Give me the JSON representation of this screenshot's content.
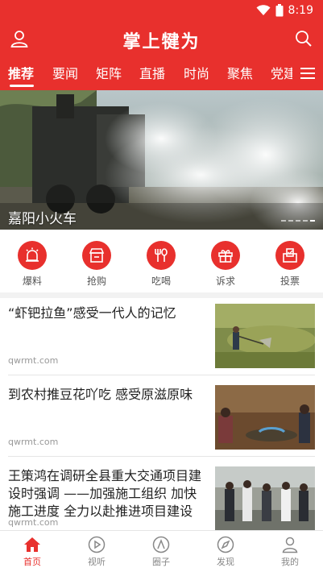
{
  "status_bar": {
    "time": "8:19"
  },
  "header": {
    "title": "掌上犍为"
  },
  "tabs": [
    {
      "label": "推荐",
      "active": true
    },
    {
      "label": "要闻"
    },
    {
      "label": "矩阵"
    },
    {
      "label": "直播"
    },
    {
      "label": "时尚"
    },
    {
      "label": "聚焦"
    },
    {
      "label": "党建"
    }
  ],
  "banner": {
    "caption": "嘉阳小火车"
  },
  "quick_actions": [
    {
      "label": "爆料",
      "icon": "alarm-icon"
    },
    {
      "label": "抢购",
      "icon": "shop-icon"
    },
    {
      "label": "吃喝",
      "icon": "fork-spoon-icon"
    },
    {
      "label": "诉求",
      "icon": "gift-icon"
    },
    {
      "label": "投票",
      "icon": "ballot-icon"
    }
  ],
  "news": [
    {
      "title": "“虾钯拉鱼”感受一代人的记忆",
      "source": "qwrmt.com"
    },
    {
      "title": "到农村推豆花吖吃  感受原滋原味",
      "source": "qwrmt.com"
    },
    {
      "title": "王策鸿在调研全县重大交通项目建设时强调  ——加强施工组织 加快施工进度 全力以赴推进项目建设",
      "source": "qwrmt.com"
    }
  ],
  "bottom_nav": [
    {
      "label": "首页",
      "icon": "home-icon",
      "active": true
    },
    {
      "label": "视听",
      "icon": "play-icon"
    },
    {
      "label": "圈子",
      "icon": "circle-icon"
    },
    {
      "label": "发现",
      "icon": "compass-icon"
    },
    {
      "label": "我的",
      "icon": "profile-icon"
    }
  ],
  "colors": {
    "brand": "#e8302d",
    "text": "#222222",
    "muted": "#999999"
  }
}
